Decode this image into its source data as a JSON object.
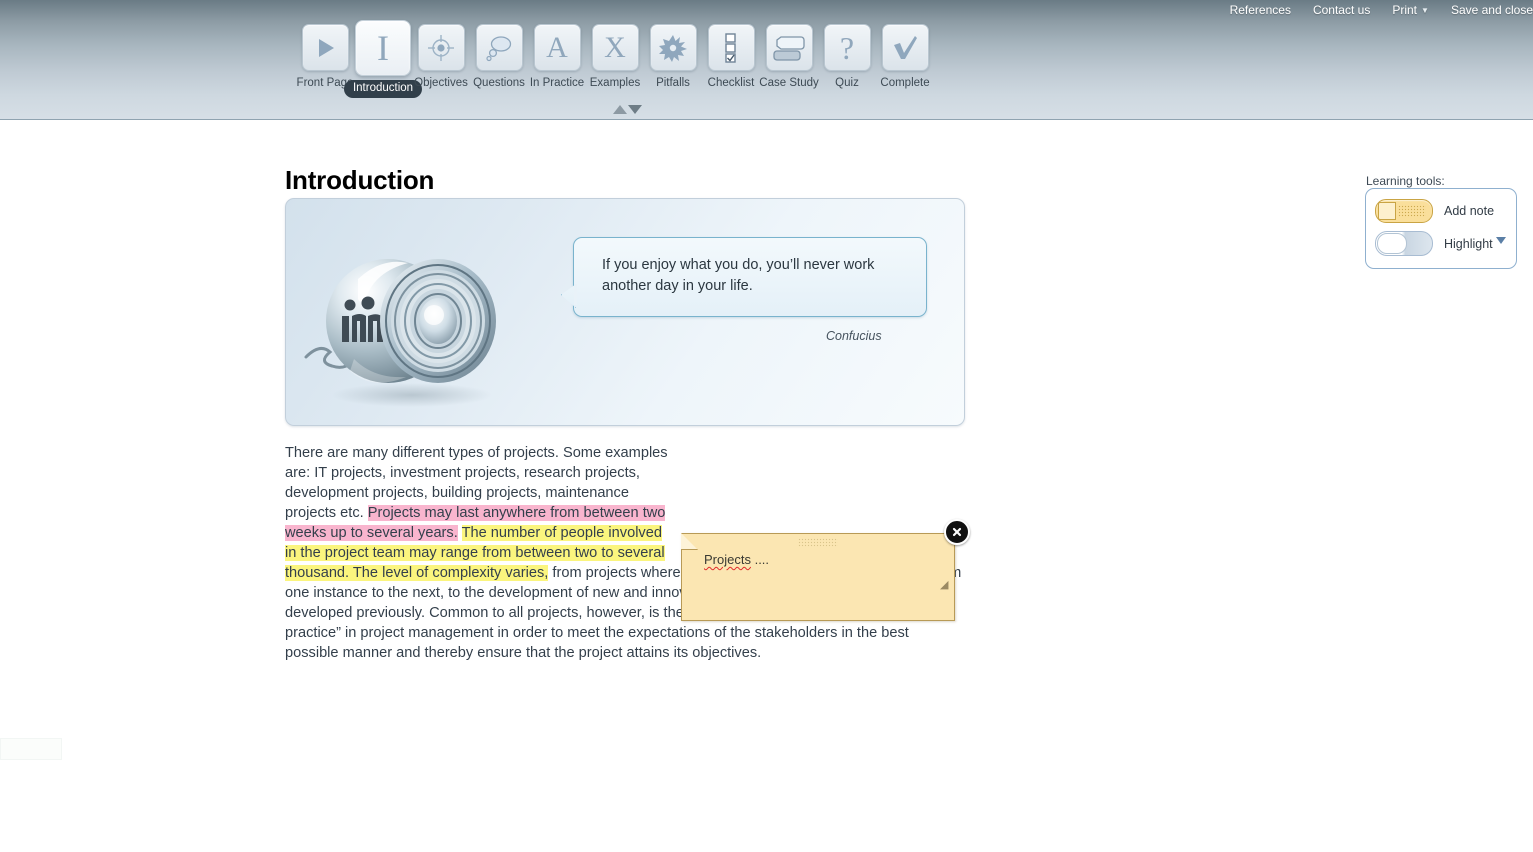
{
  "topnav": {
    "links": [
      {
        "label": "References",
        "caret": false
      },
      {
        "label": "Contact us",
        "caret": false
      },
      {
        "label": "Print",
        "caret": true
      },
      {
        "label": "Save and close",
        "caret": false
      }
    ]
  },
  "coursenav": {
    "items": [
      {
        "label": "Front Page",
        "icon": "play-icon",
        "active": false
      },
      {
        "label": "Introduction",
        "icon": "letter-i-icon",
        "active": true
      },
      {
        "label": "Objectives",
        "icon": "target-icon",
        "active": false
      },
      {
        "label": "Questions",
        "icon": "speech-bubble-icon",
        "active": false
      },
      {
        "label": "In Practice",
        "icon": "letter-a-icon",
        "active": false
      },
      {
        "label": "Examples",
        "icon": "letter-x-icon",
        "active": false
      },
      {
        "label": "Pitfalls",
        "icon": "splat-icon",
        "active": false
      },
      {
        "label": "Checklist",
        "icon": "checklist-icon",
        "active": false
      },
      {
        "label": "Case Study",
        "icon": "case-study-icon",
        "active": false
      },
      {
        "label": "Quiz",
        "icon": "question-mark-icon",
        "active": false
      },
      {
        "label": "Complete",
        "icon": "checkmark-icon",
        "active": false
      }
    ],
    "collapse_toggle": "up-down-arrows-icon"
  },
  "page": {
    "title": "Introduction"
  },
  "hero": {
    "image_alt": "chrome-sphere-illustration",
    "quote": "If you enjoy what you do, you’ll never work another day in your life.",
    "attribution": "Confucius"
  },
  "body": {
    "segments": [
      {
        "text": "There are many different types of projects. Some examples are: IT projects, investment projects, research projects, development projects, building projects, maintenance projects etc. ",
        "highlight": "none"
      },
      {
        "text": "Projects may last anywhere from between two weeks up to several years.",
        "highlight": "pink"
      },
      {
        "text": " ",
        "highlight": "none"
      },
      {
        "text": "The number of people involved in the project team may range from between two to several thousand. The level of complexity varies,",
        "highlight": "yellow"
      },
      {
        "text": " from projects where the challenges are more or less equal from one instance to the next, to the development of new and innovative solutions that have never been developed previously. Common to all projects, however, is the fact that one should always apply “good practice” in project management in order to meet the expectations of the stakeholders in the best possible manner and thereby ensure that the project attains its objectives.",
        "highlight": "none"
      }
    ]
  },
  "note": {
    "text": "Projects",
    "text_suffix": " ....",
    "close_label": "close-note",
    "grip_label": "drag-handle",
    "resize_label": "resize-handle"
  },
  "learning_tools": {
    "title": "Learning tools:",
    "add_note_label": "Add note",
    "highlight_label": "Highlight",
    "add_note_state": "on",
    "highlight_state": "off",
    "dropdown_icon": "chevron-down-icon"
  },
  "colors": {
    "highlight_pink": "#f9b5ce",
    "highlight_yellow": "#fbf57e",
    "note_background": "#fbe6b2",
    "header_gradient_top": "#6a7b85",
    "header_gradient_bottom": "#d6dfe6",
    "nav_icon": "#90a7bc",
    "active_pill": "#313f4a",
    "body_text": "#333f4b",
    "panel_border": "#8fb0cf"
  }
}
